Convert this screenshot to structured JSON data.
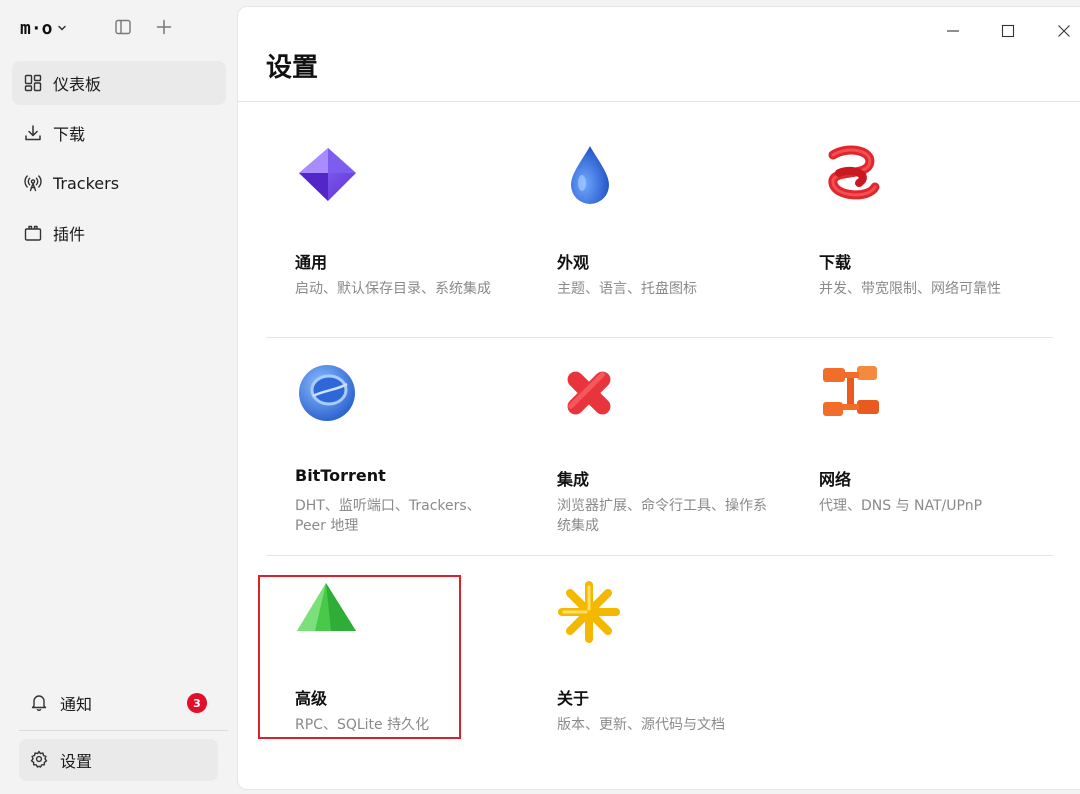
{
  "app": {
    "logo_text": "m·o",
    "logo_icon": "chevron-down-icon",
    "sidebar_toggle_icon": "sidebar-toggle-icon",
    "new_icon": "plus-icon"
  },
  "sidebar": {
    "items": [
      {
        "label": "仪表板",
        "icon": "dashboard-icon",
        "active": true
      },
      {
        "label": "下载",
        "icon": "download-icon",
        "active": false
      },
      {
        "label": "Trackers",
        "icon": "antenna-icon",
        "active": false
      },
      {
        "label": "插件",
        "icon": "plugin-icon",
        "active": false
      }
    ],
    "notifications": {
      "label": "通知",
      "count": "3",
      "icon": "bell-icon"
    },
    "settings": {
      "label": "设置",
      "icon": "gear-icon"
    }
  },
  "window": {
    "minimize_icon": "minimize-icon",
    "maximize_icon": "maximize-icon",
    "close_icon": "close-icon"
  },
  "page": {
    "title": "设置",
    "cards": [
      {
        "title": "通用",
        "desc": "启动、默认保存目录、系统集成",
        "icon": "purple-diamond-icon"
      },
      {
        "title": "外观",
        "desc": "主题、语言、托盘图标",
        "icon": "blue-drop-icon"
      },
      {
        "title": "下载",
        "desc": "并发、带宽限制、网络可靠性",
        "icon": "red-coil-icon"
      },
      {
        "title": "BitTorrent",
        "desc": "DHT、监听端口、Trackers、Peer 地理",
        "icon": "blue-sphere-icon"
      },
      {
        "title": "集成",
        "desc": "浏览器扩展、命令行工具、操作系统集成",
        "icon": "red-cross-icon"
      },
      {
        "title": "网络",
        "desc": "代理、DNS 与 NAT/UPnP",
        "icon": "orange-network-icon"
      },
      {
        "title": "高级",
        "desc": "RPC、SQLite 持久化",
        "icon": "green-pyramid-icon",
        "highlighted": true
      },
      {
        "title": "关于",
        "desc": "版本、更新、源代码与文档",
        "icon": "yellow-star-icon"
      }
    ]
  },
  "colors": {
    "highlight_border": "#d9232b",
    "badge": "#e0102a",
    "sidebar_bg": "#f3f3f3",
    "panel_bg": "#ffffff"
  }
}
